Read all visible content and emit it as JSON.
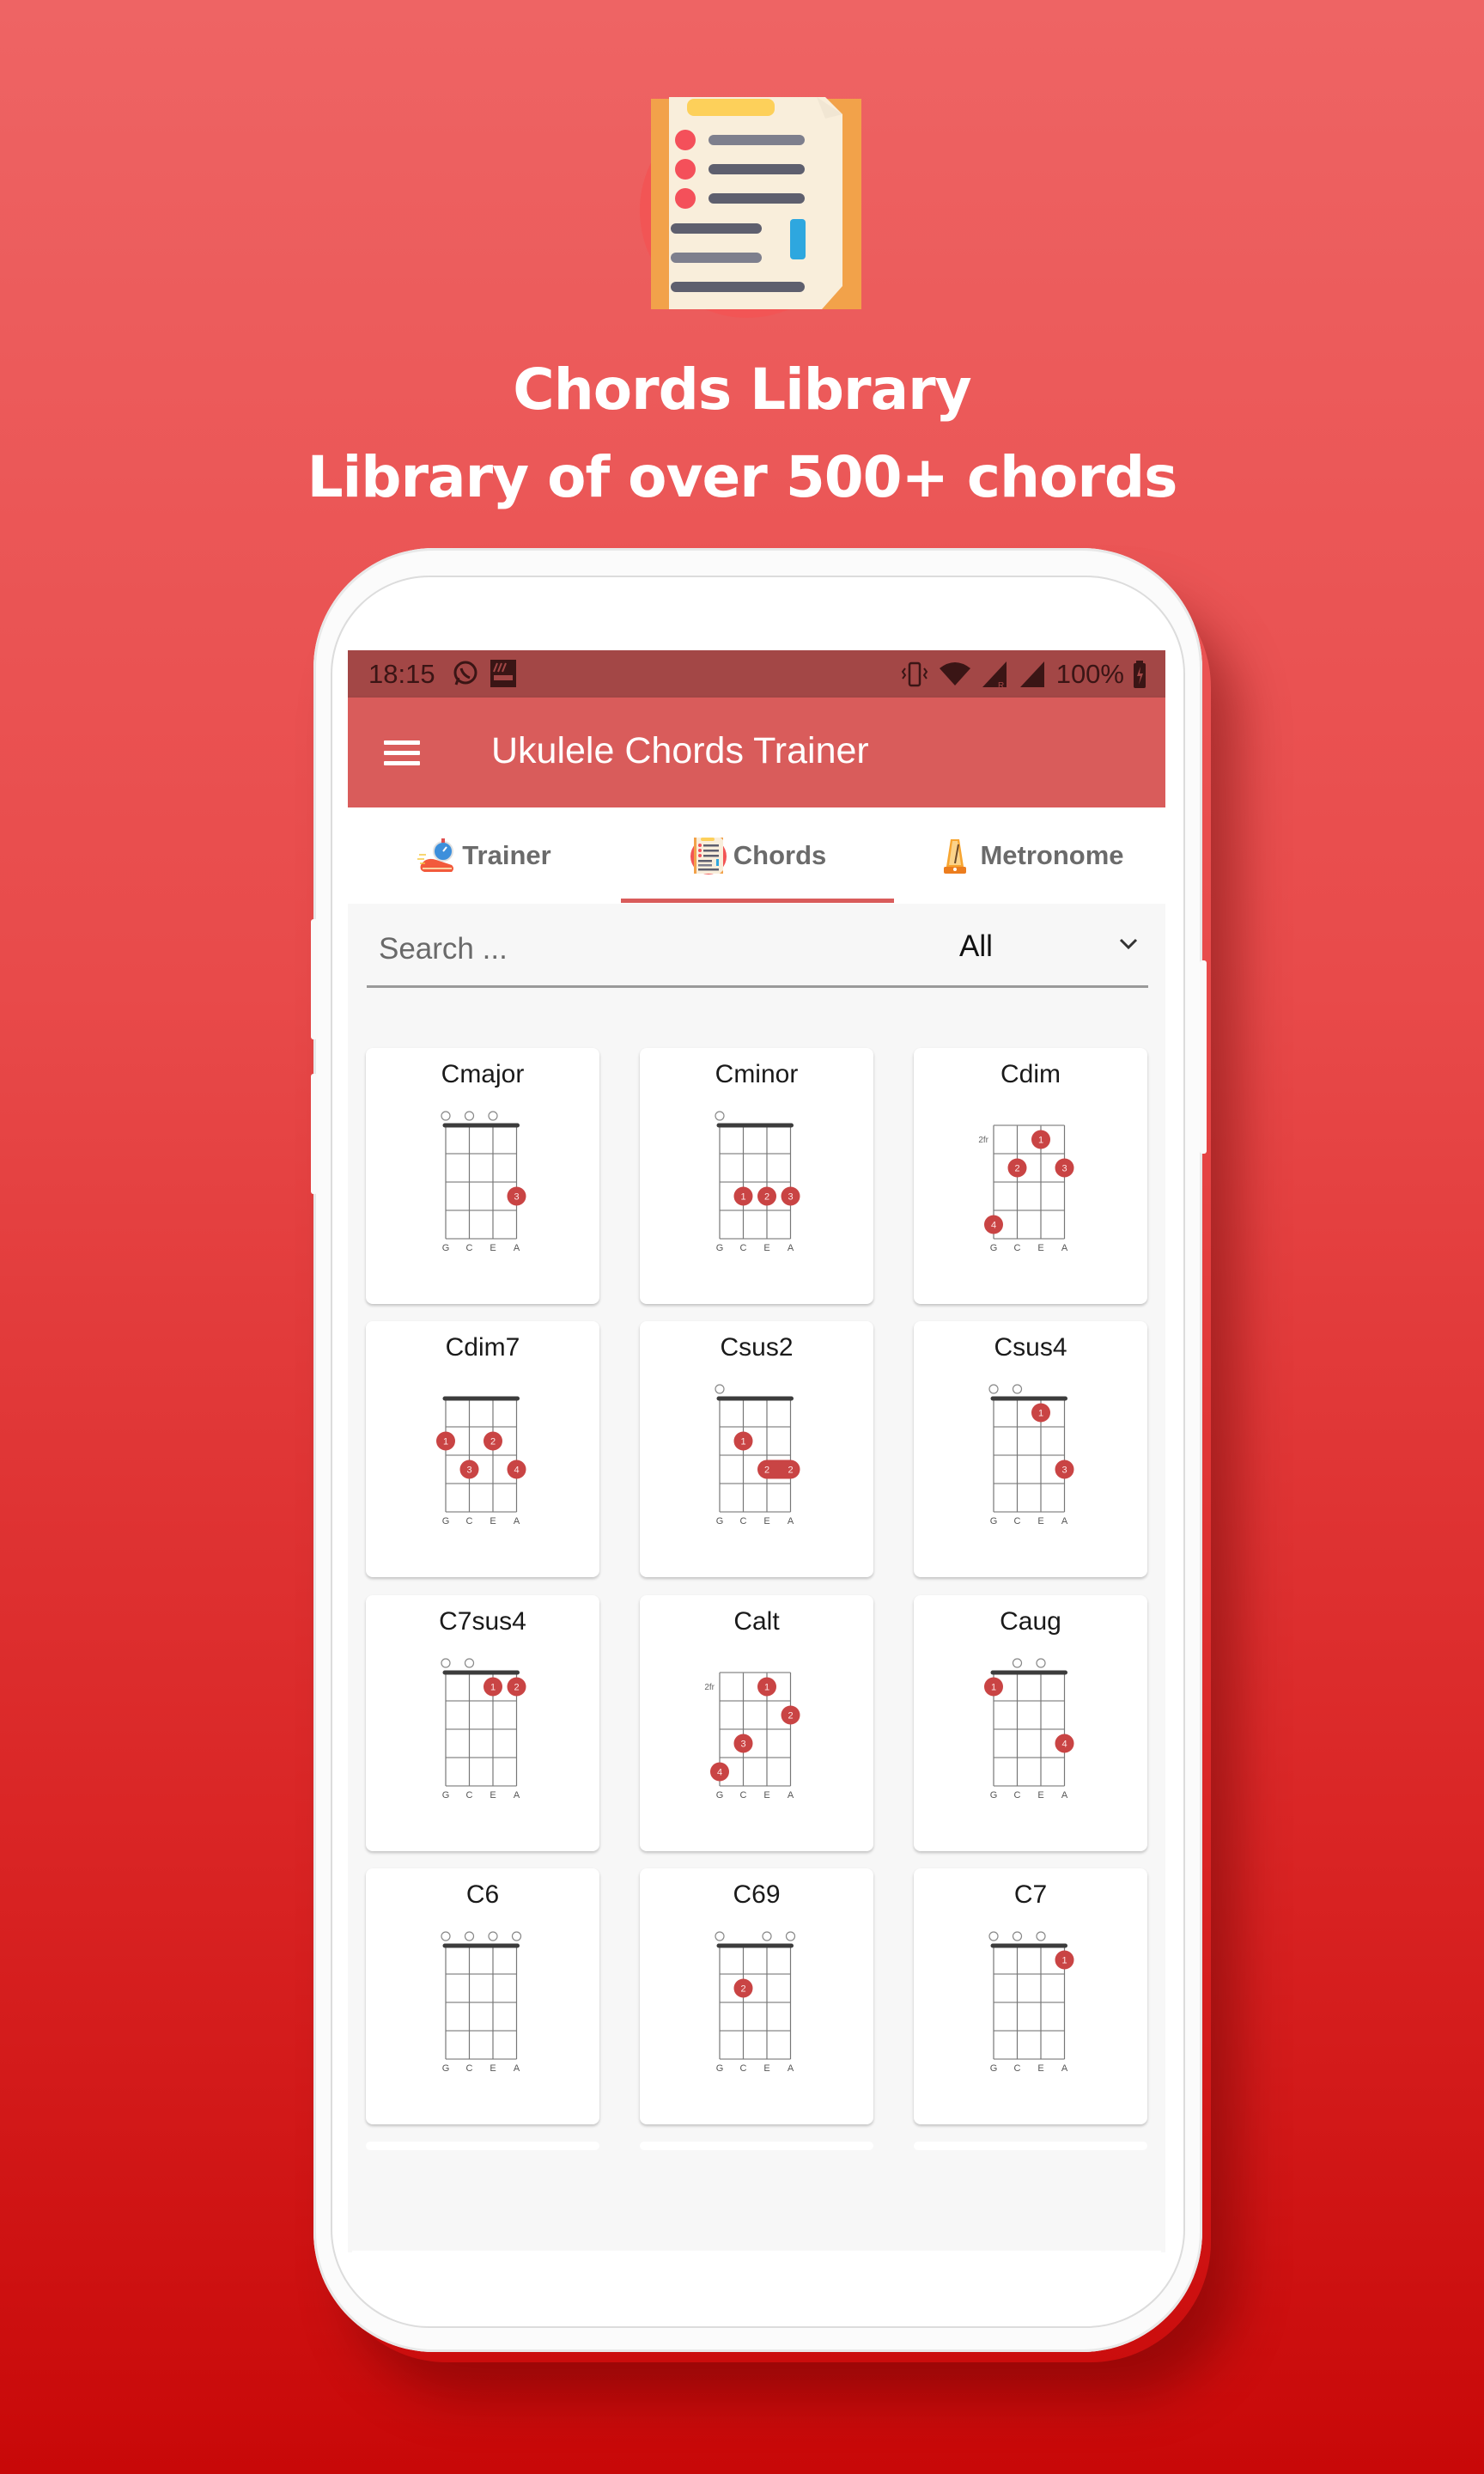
{
  "promo": {
    "icon": "clipboard-list-icon",
    "headline": "Chords Library",
    "subheadline": "Library of over 500+ chords"
  },
  "status_bar": {
    "time": "18:15",
    "left_icons": [
      "whatsapp-icon",
      "aldi-app-icon"
    ],
    "right_icons": [
      "vibrate-icon",
      "wifi-icon",
      "signal-roaming-icon",
      "signal-icon"
    ],
    "battery": "100%"
  },
  "app_bar": {
    "menu_icon": "hamburger-menu-icon",
    "title": "Ukulele Chords Trainer"
  },
  "tabs": [
    {
      "label": "Trainer",
      "icon": "stopwatch-sneaker-icon",
      "active": false
    },
    {
      "label": "Chords",
      "icon": "clipboard-list-icon",
      "active": true
    },
    {
      "label": "Metronome",
      "icon": "metronome-icon",
      "active": false
    }
  ],
  "colors": {
    "primary": "#d95c5b",
    "status_bar": "#a34746",
    "finger_dot": "#c94444"
  },
  "search": {
    "placeholder": "Search ...",
    "value": "",
    "filter_selected": "All"
  },
  "tuning": [
    "G",
    "C",
    "E",
    "A"
  ],
  "chords": [
    {
      "name": "Cmajor",
      "base_fret": 1,
      "open": [
        0,
        1,
        2
      ],
      "fingers": [
        {
          "string": 3,
          "fret": 3,
          "finger": "3"
        }
      ]
    },
    {
      "name": "Cminor",
      "base_fret": 1,
      "open": [
        0
      ],
      "fingers": [
        {
          "string": 1,
          "fret": 3,
          "finger": "1"
        },
        {
          "string": 2,
          "fret": 3,
          "finger": "2"
        },
        {
          "string": 3,
          "fret": 3,
          "finger": "3"
        }
      ]
    },
    {
      "name": "Cdim",
      "base_fret": 2,
      "base_fret_label": "2fr",
      "open": [],
      "fingers": [
        {
          "string": 2,
          "fret": 1,
          "finger": "1"
        },
        {
          "string": 1,
          "fret": 2,
          "finger": "2"
        },
        {
          "string": 3,
          "fret": 2,
          "finger": "3"
        },
        {
          "string": 0,
          "fret": 4,
          "finger": "4"
        }
      ]
    },
    {
      "name": "Cdim7",
      "base_fret": 1,
      "open": [],
      "fingers": [
        {
          "string": 0,
          "fret": 2,
          "finger": "1"
        },
        {
          "string": 2,
          "fret": 2,
          "finger": "2"
        },
        {
          "string": 1,
          "fret": 3,
          "finger": "3"
        },
        {
          "string": 3,
          "fret": 3,
          "finger": "4"
        }
      ]
    },
    {
      "name": "Csus2",
      "base_fret": 1,
      "open": [
        0
      ],
      "fingers": [
        {
          "string": 1,
          "fret": 2,
          "finger": "1"
        }
      ],
      "barres": [
        {
          "from": 2,
          "to": 3,
          "fret": 3,
          "finger": "2"
        }
      ]
    },
    {
      "name": "Csus4",
      "base_fret": 1,
      "open": [
        0,
        1
      ],
      "fingers": [
        {
          "string": 2,
          "fret": 1,
          "finger": "1"
        },
        {
          "string": 3,
          "fret": 3,
          "finger": "3"
        }
      ]
    },
    {
      "name": "C7sus4",
      "base_fret": 1,
      "open": [
        0,
        1
      ],
      "fingers": [
        {
          "string": 2,
          "fret": 1,
          "finger": "1"
        },
        {
          "string": 3,
          "fret": 1,
          "finger": "2"
        }
      ]
    },
    {
      "name": "Calt",
      "base_fret": 2,
      "base_fret_label": "2fr",
      "open": [],
      "fingers": [
        {
          "string": 2,
          "fret": 1,
          "finger": "1"
        },
        {
          "string": 3,
          "fret": 2,
          "finger": "2"
        },
        {
          "string": 1,
          "fret": 3,
          "finger": "3"
        },
        {
          "string": 0,
          "fret": 4,
          "finger": "4"
        }
      ]
    },
    {
      "name": "Caug",
      "base_fret": 1,
      "open": [
        1,
        2
      ],
      "fingers": [
        {
          "string": 0,
          "fret": 1,
          "finger": "1"
        },
        {
          "string": 3,
          "fret": 3,
          "finger": "4"
        }
      ]
    },
    {
      "name": "C6",
      "base_fret": 1,
      "open": [
        0,
        1,
        2,
        3
      ],
      "fingers": []
    },
    {
      "name": "C69",
      "base_fret": 1,
      "open": [
        0,
        2,
        3
      ],
      "fingers": [
        {
          "string": 1,
          "fret": 2,
          "finger": "2"
        }
      ]
    },
    {
      "name": "C7",
      "base_fret": 1,
      "open": [
        0,
        1,
        2
      ],
      "fingers": [
        {
          "string": 3,
          "fret": 1,
          "finger": "1"
        }
      ]
    }
  ]
}
